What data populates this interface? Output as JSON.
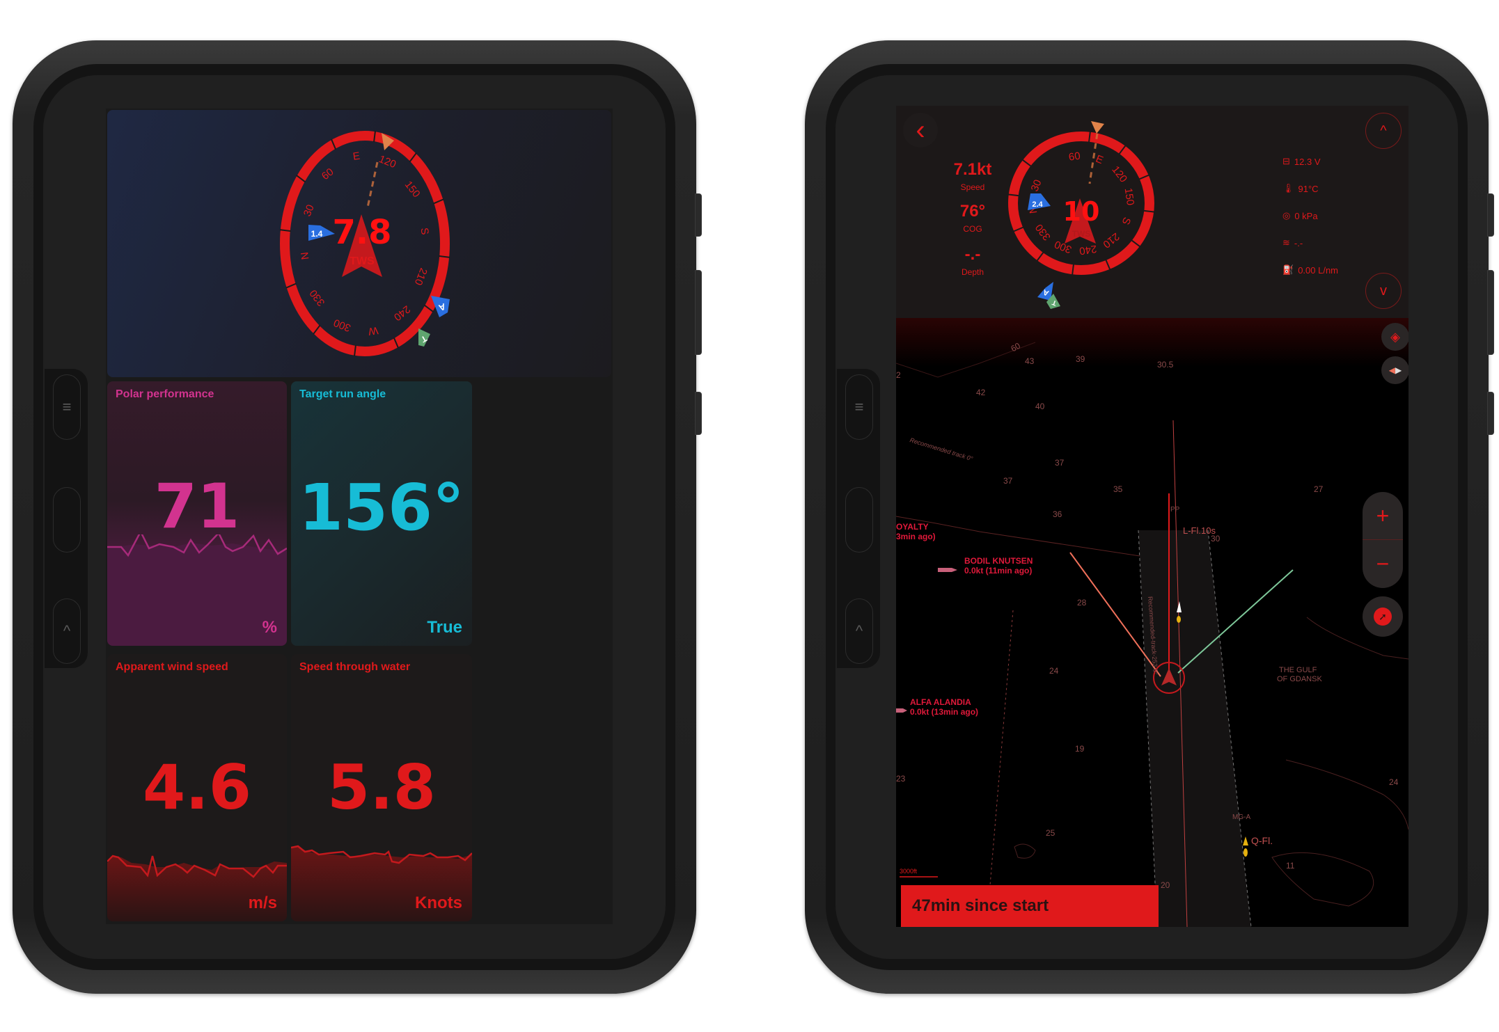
{
  "colors": {
    "accent_red": "#e0191b",
    "magenta": "#d2338f",
    "cyan": "#17bcd6",
    "wind_blue": "#2a6fe0",
    "true_green": "#5fa56f",
    "heading_orange": "#e0834a",
    "ais_pink": "#e0193a"
  },
  "left_tablet": {
    "compass": {
      "center_value": "7.8",
      "center_label": "TWS",
      "wind_flag": "1.4",
      "apparent_marker": "A",
      "true_marker": "T",
      "ring_labels": [
        "E",
        "120",
        "150",
        "S",
        "210",
        "240",
        "W",
        "300",
        "330",
        "N",
        "30",
        "60"
      ],
      "heading_deg": 100
    },
    "tiles": [
      {
        "title": "Polar performance",
        "value": "71",
        "unit": "%"
      },
      {
        "title": "Target run angle",
        "value": "156°",
        "unit": "True"
      },
      {
        "title": "Apparent wind speed",
        "value": "4.6",
        "unit": "m/s"
      },
      {
        "title": "Speed through water",
        "value": "5.8",
        "unit": "Knots"
      }
    ],
    "side_buttons": {
      "menu": "≡",
      "up": "^"
    }
  },
  "right_tablet": {
    "back_icon": "‹",
    "stats_left": [
      {
        "value": "7.1kt",
        "label": "Speed"
      },
      {
        "value": "76°",
        "label": "COG"
      },
      {
        "value": "-.-",
        "label": "Depth"
      }
    ],
    "compass": {
      "center_value": "10",
      "center_label": "TWS",
      "wind_flag": "2.4",
      "apparent_marker": "A",
      "true_marker": "T",
      "ring_labels": [
        "60",
        "E",
        "120",
        "150",
        "S",
        "210",
        "240",
        "300",
        "330",
        "N",
        "30"
      ]
    },
    "stats_right": [
      {
        "icon": "battery-icon",
        "glyph": "⊟",
        "value": "12.3 V"
      },
      {
        "icon": "temperature-icon",
        "glyph": "🌡",
        "value": "91°C"
      },
      {
        "icon": "pressure-icon",
        "glyph": "◎",
        "value": "0 kPa"
      },
      {
        "icon": "signal-icon",
        "glyph": "≋",
        "value": "-.-"
      },
      {
        "icon": "fuel-icon",
        "glyph": "⛽",
        "value": "0.00 L/nm"
      }
    ],
    "scroll_up": "^",
    "scroll_down": "v",
    "map": {
      "depths": [
        {
          "v": "43"
        },
        {
          "v": "39"
        },
        {
          "v": "30.5"
        },
        {
          "v": "42"
        },
        {
          "v": "40"
        },
        {
          "v": "37"
        },
        {
          "v": "37"
        },
        {
          "v": "35"
        },
        {
          "v": "27"
        },
        {
          "v": "36"
        },
        {
          "v": "30"
        },
        {
          "v": "28"
        },
        {
          "v": "24"
        },
        {
          "v": "19"
        },
        {
          "v": "23"
        },
        {
          "v": "25"
        },
        {
          "v": "24"
        },
        {
          "v": "11"
        },
        {
          "v": "20"
        },
        {
          "v": "2"
        },
        {
          "v": "60"
        }
      ],
      "track_label_1": "Recommended track 0°",
      "track_label_2": "Recommended-track-253.6°",
      "buoy_1": {
        "top": "PP",
        "label": "L-Fl.10s"
      },
      "buoy_2": {
        "top": "MG-A",
        "label": "Q-Fl."
      },
      "area_label_1": "THE GULF",
      "area_label_2": "OF GDANSK",
      "scale": "3000ft",
      "ais": [
        {
          "name": "OYALTY",
          "info": "3min ago)"
        },
        {
          "name": "BODIL KNUTSEN",
          "info": "0.0kt (11min ago)"
        },
        {
          "name": "ALFA ALANDIA",
          "info": "0.0kt (13min ago)"
        }
      ],
      "zoom_in": "+",
      "zoom_out": "−"
    },
    "banner": "47min since start",
    "side_buttons": {
      "menu": "≡",
      "up": "^"
    }
  }
}
